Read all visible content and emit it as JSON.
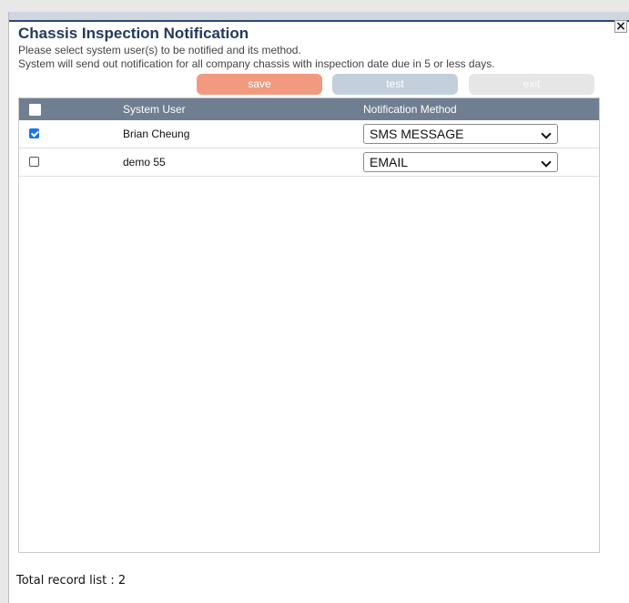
{
  "dialog": {
    "title": "Chassis Inspection Notification",
    "line1": "Please select system user(s) to be notified and its method.",
    "line2": "System will send out notification for all company chassis with inspection date due in 5 or less days.",
    "close_label": "×"
  },
  "buttons": {
    "save": "save",
    "test": "test",
    "exit": "exit"
  },
  "table": {
    "headers": {
      "user": "System User",
      "method": "Notification Method"
    },
    "rows": [
      {
        "checked": true,
        "user": "Brian Cheung",
        "method": "SMS MESSAGE"
      },
      {
        "checked": false,
        "user": "demo 55",
        "method": "EMAIL"
      }
    ]
  },
  "footer": {
    "total_label": "Total record list : 2"
  },
  "colors": {
    "title": "#243a5a",
    "header_bg": "#6f7f91",
    "save_btn": "#f19a80",
    "test_btn": "#c4cfde",
    "exit_btn": "#e6e6e6",
    "checkbox_checked": "#1a73e8"
  }
}
